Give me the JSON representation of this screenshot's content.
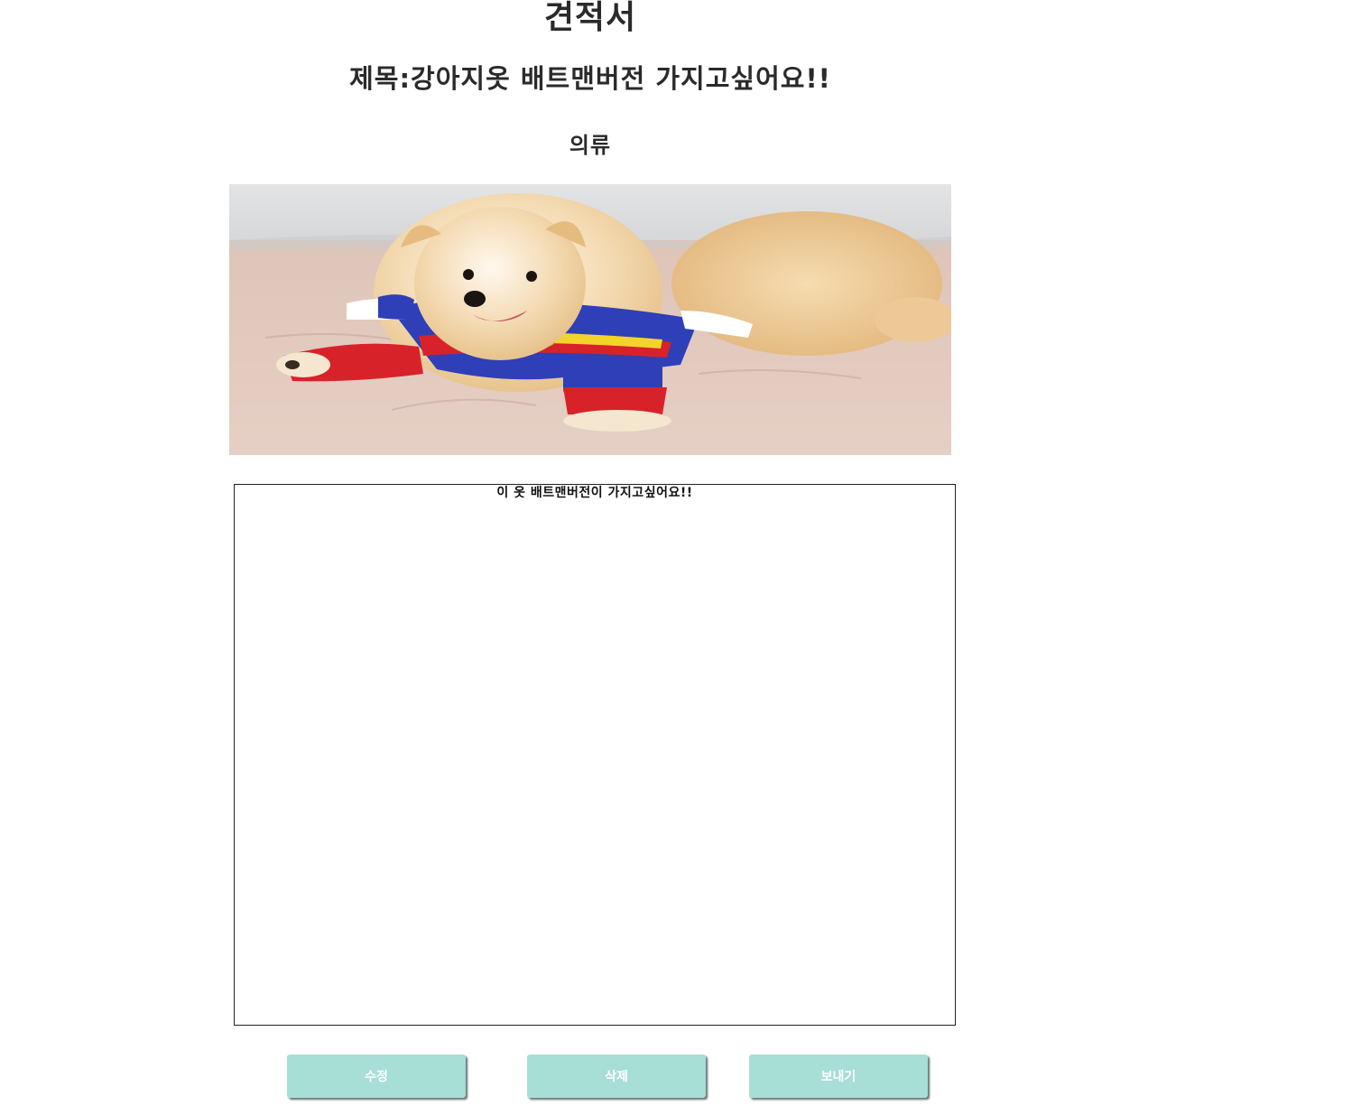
{
  "page": {
    "doc_title": "견적서",
    "post_title": "제목:강아지옷 배트맨버전 가지고싶어요!!",
    "category": "의류"
  },
  "photo": {
    "subject": "pomeranian-dog-in-costume"
  },
  "content": {
    "text": "이 옷 배트맨버전이 가지고싶어요!!"
  },
  "buttons": {
    "edit": "수정",
    "delete": "삭제",
    "send": "보내기"
  },
  "colors": {
    "button_bg": "#a7ded5",
    "button_text": "#ffffff",
    "heading_text": "#2a2a2a"
  }
}
